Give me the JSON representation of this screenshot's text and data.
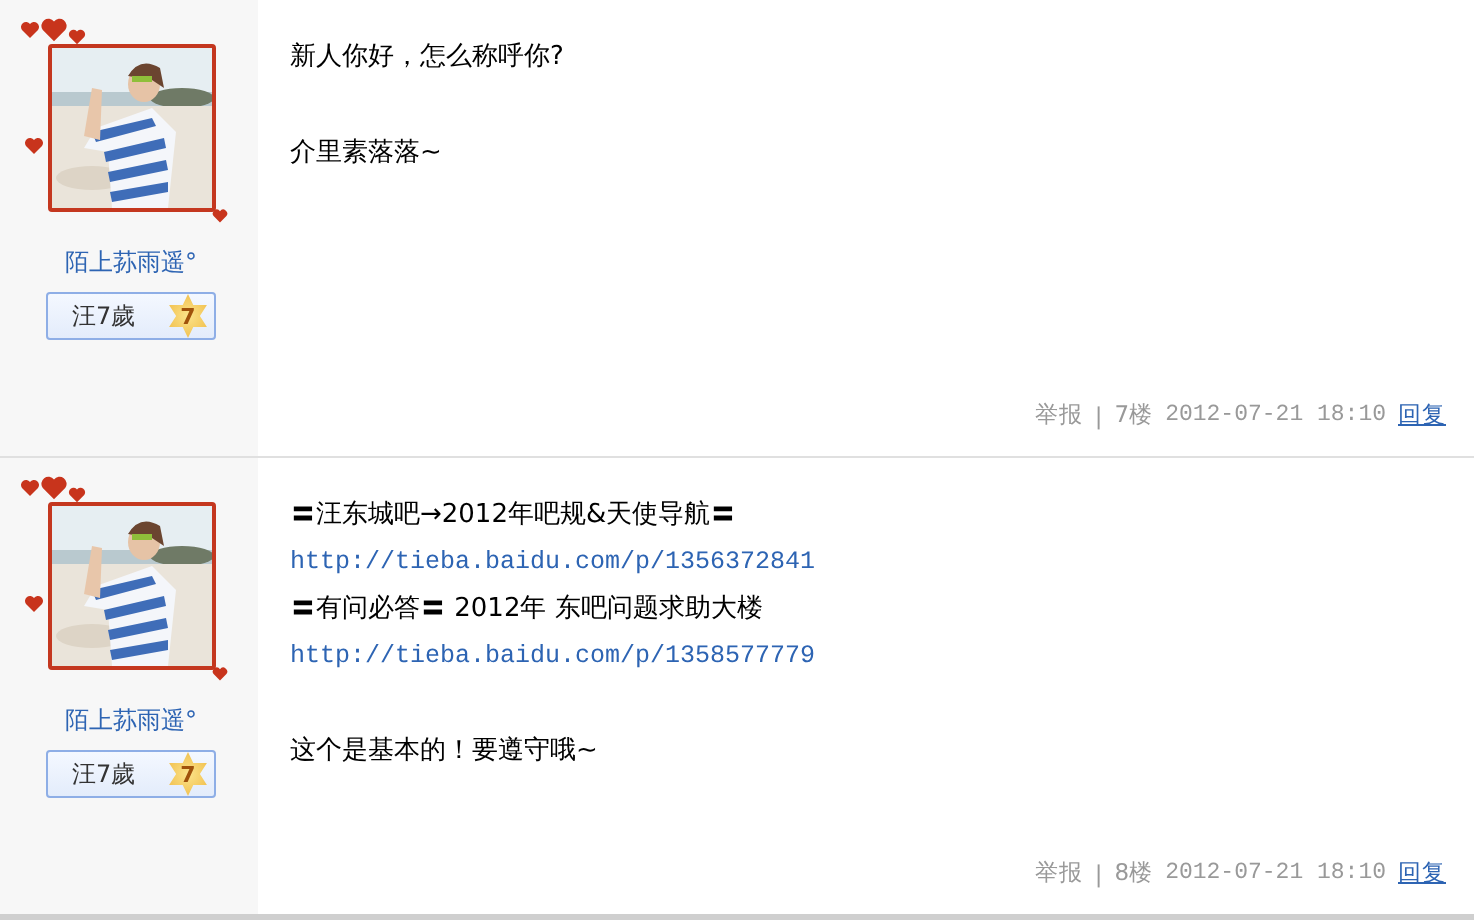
{
  "posts": [
    {
      "author": {
        "name": "陌上荪雨遥°",
        "badge": "汪7歲",
        "level": "7"
      },
      "content": [
        {
          "kind": "text",
          "text": "新人你好，怎么称呼你?",
          "spaced": false
        },
        {
          "kind": "text",
          "text": "介里素落落~",
          "spaced": true
        }
      ],
      "footer": {
        "report": "举报",
        "separator": "|",
        "floor": "7楼",
        "time": "2012-07-21 18:10",
        "reply": "回复"
      }
    },
    {
      "author": {
        "name": "陌上荪雨遥°",
        "badge": "汪7歲",
        "level": "7"
      },
      "content": [
        {
          "kind": "text",
          "text": "〓汪东城吧→2012年吧规&天使导航〓",
          "spaced": false
        },
        {
          "kind": "link",
          "text": "http://tieba.baidu.com/p/1356372841",
          "spaced": false
        },
        {
          "kind": "text",
          "text": "〓有问必答〓 2012年 东吧问题求助大楼",
          "spaced": false
        },
        {
          "kind": "link",
          "text": "http://tieba.baidu.com/p/1358577779",
          "spaced": false
        },
        {
          "kind": "text",
          "text": "这个是基本的！要遵守哦~",
          "spaced": true
        }
      ],
      "footer": {
        "report": "举报",
        "separator": "|",
        "floor": "8楼",
        "time": "2012-07-21 18:10",
        "reply": "回复"
      }
    }
  ]
}
